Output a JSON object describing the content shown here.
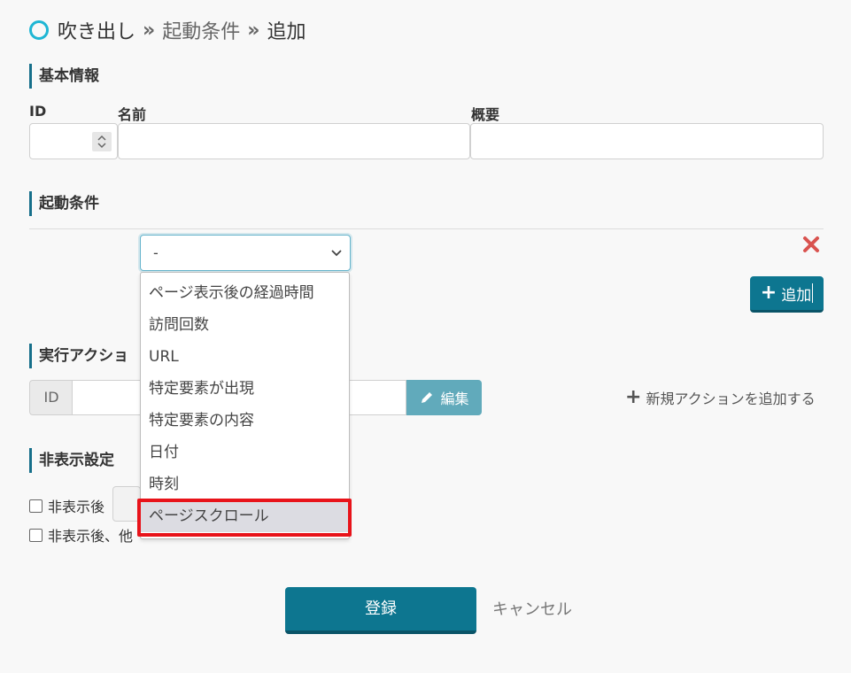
{
  "breadcrumb": {
    "items": [
      "吹き出し",
      "起動条件",
      "追加"
    ],
    "separator": "»"
  },
  "basic_info": {
    "heading": "基本情報",
    "id_label": "ID",
    "name_label": "名前",
    "summary_label": "概要",
    "id_value": "",
    "name_value": "",
    "summary_value": ""
  },
  "trigger": {
    "heading": "起動条件",
    "select_value": "-",
    "options": [
      "ページ表示後の経過時間",
      "訪問回数",
      "URL",
      "特定要素が出現",
      "特定要素の内容",
      "日付",
      "時刻",
      "ページスクロール"
    ],
    "highlighted_option": "ページスクロール",
    "add_label": "追加",
    "delete_icon": "close-icon"
  },
  "action": {
    "heading": "実行アクショ",
    "id_addon": "ID",
    "edit_label": "編集",
    "new_action_label": "新規アクションを追加する"
  },
  "hide": {
    "heading": "非表示設定",
    "option1_label": "非表示後",
    "option2_label": "非表示後、他"
  },
  "footer": {
    "submit_label": "登録",
    "cancel_label": "キャンセル"
  },
  "colors": {
    "accent": "#0d7690",
    "accent_light": "#61aabb",
    "breadcrumb_circle": "#1fb6d4",
    "delete_red": "#d9534f",
    "highlight_red": "#e8131a"
  }
}
